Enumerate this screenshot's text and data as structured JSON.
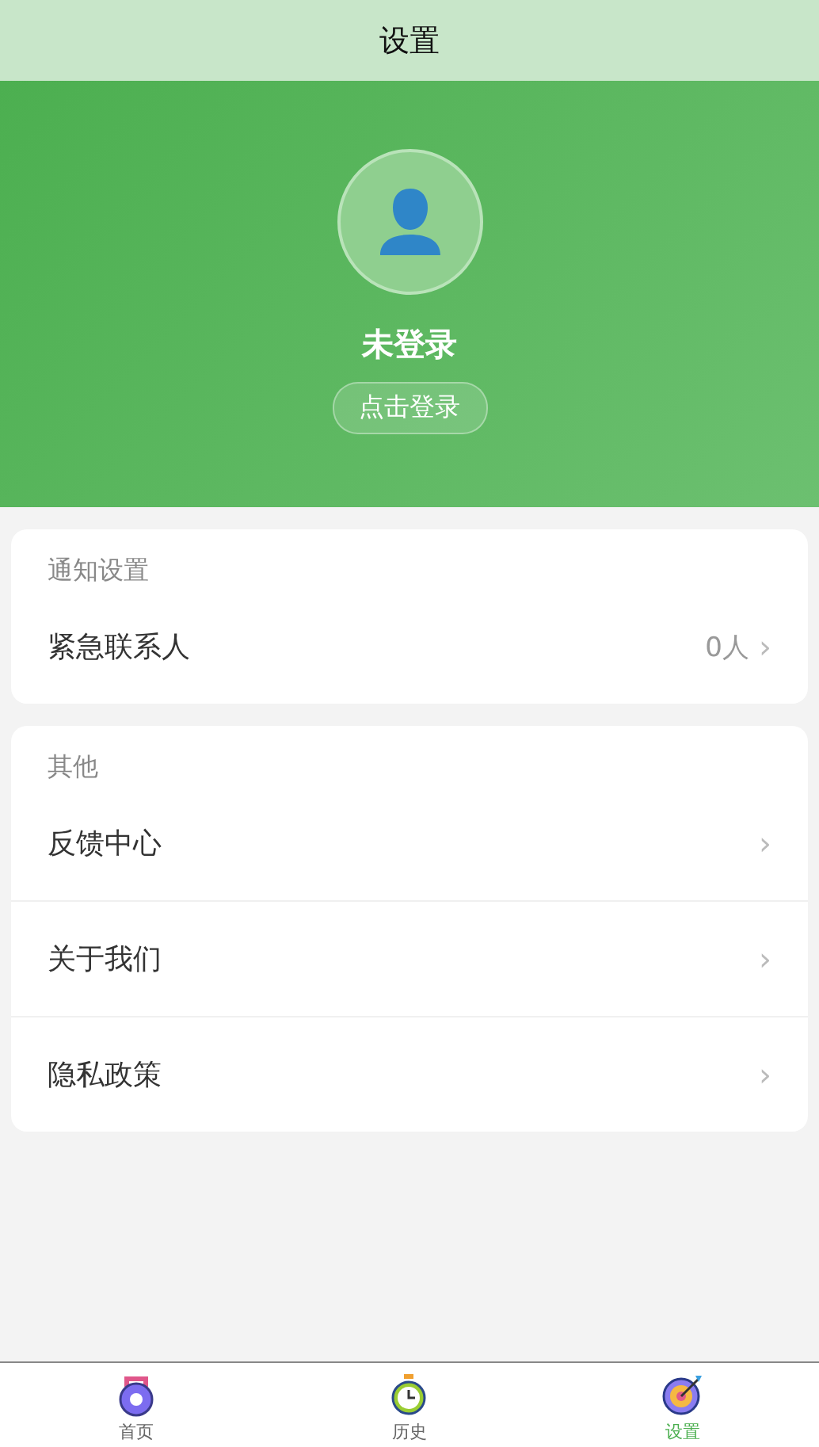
{
  "header": {
    "title": "设置"
  },
  "profile": {
    "name": "未登录",
    "login_button": "点击登录"
  },
  "sections": [
    {
      "title": "通知设置",
      "items": [
        {
          "label": "紧急联系人",
          "value": "0人",
          "chevron": "›"
        }
      ]
    },
    {
      "title": "其他",
      "items": [
        {
          "label": "反馈中心",
          "chevron": "›"
        },
        {
          "label": "关于我们",
          "chevron": "›"
        },
        {
          "label": "隐私政策",
          "chevron": "›"
        }
      ]
    }
  ],
  "tab_bar": [
    {
      "label": "首页",
      "kind": "kettlebell",
      "selected": false
    },
    {
      "label": "历史",
      "kind": "stopwatch",
      "selected": false
    },
    {
      "label": "设置",
      "kind": "target",
      "selected": true
    }
  ]
}
